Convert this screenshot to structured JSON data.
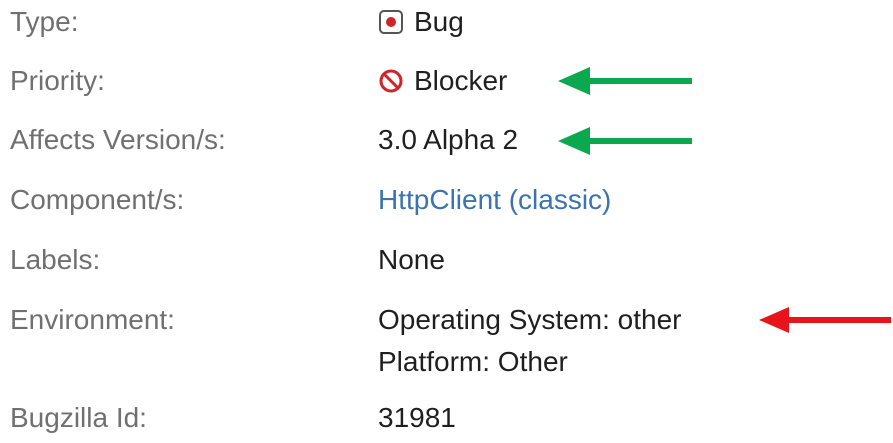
{
  "fields": {
    "type": {
      "label": "Type:",
      "value": "Bug",
      "icon": "bug-icon"
    },
    "priority": {
      "label": "Priority:",
      "value": "Blocker",
      "icon": "blocker-icon"
    },
    "affects_version": {
      "label": "Affects Version/s:",
      "value": "3.0 Alpha 2"
    },
    "components": {
      "label": "Component/s:",
      "value": "HttpClient (classic)"
    },
    "labels": {
      "label": "Labels:",
      "value": "None"
    },
    "environment": {
      "label": "Environment:",
      "line1": "Operating System: other",
      "line2": "Platform: Other"
    },
    "bugzilla_id": {
      "label": "Bugzilla Id:",
      "value": "31981"
    }
  },
  "annotations": {
    "priority_arrow_color": "#0aa84f",
    "version_arrow_color": "#0aa84f",
    "environment_arrow_color": "#e8141c"
  },
  "colors": {
    "label": "#707070",
    "value": "#1f1f1f",
    "link": "#3b73af",
    "bug_icon": "#d0232a",
    "blocker_icon": "#d0232a"
  }
}
